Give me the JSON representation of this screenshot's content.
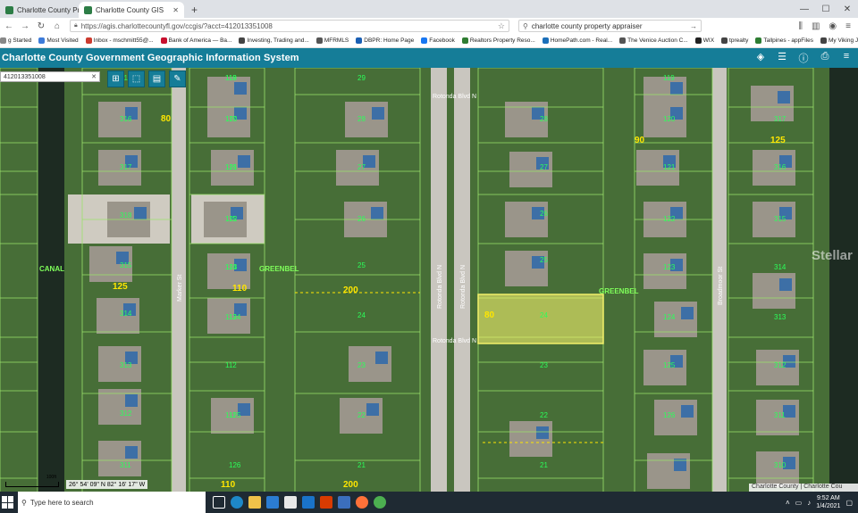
{
  "browser": {
    "tabs": [
      {
        "title": "Charlotte County Property App",
        "active": false,
        "color": "#2d7d46"
      },
      {
        "title": "Charlotte County GIS",
        "active": true,
        "color": "#2d7d46"
      }
    ],
    "new_tab": "+",
    "url": "https://agis.charlottecountyfl.gov/ccgis/?acct=412013351008",
    "search_value": "charlotte county property appraiser",
    "bookmarks": [
      "g Started",
      "Most Visited",
      "Inbox - mschmitt55@...",
      "Bank of America — Ba...",
      "Investing, Trading and...",
      "MFRMLS",
      "DBPR: Home Page",
      "Facebook",
      "Realtors Property Reso...",
      "HomePath.com - Real...",
      "The Venice Auction C...",
      "WIX",
      "tprealty",
      "Tallpines - appFiles",
      "My Viking Journey - Vi..."
    ]
  },
  "app": {
    "title": "Charlotte County Government Geographic Information System",
    "accent": "#157d98",
    "header_icons": [
      "layers-icon",
      "list-icon",
      "info-icon",
      "print-icon",
      "menu-icon"
    ]
  },
  "map": {
    "search_value": "412013351008",
    "clear_label": "✕",
    "tools": [
      "grid-icon",
      "select-icon",
      "notes-icon",
      "edit-icon"
    ],
    "highlight_color": "#f2f06a",
    "lot_line_color": "#9be36b",
    "lot_text_color": "#ffe600",
    "labels": {
      "canal": "CANAL",
      "greenbelt_left": "GREENBEL",
      "greenbelt_right": "GREENBEL",
      "rotonda_top": "Rotonda Blvd N",
      "rotonda_mid": "Rotonda Blvd N",
      "rotonda_v1": "Rotonda Blvd N",
      "rotonda_v2": "Rotonda Blvd N",
      "marker_st": "Marker St",
      "broadmoor_st": "Broadmoor St"
    },
    "lots": [
      "118",
      "117",
      "116",
      "115",
      "114",
      "113",
      "112",
      "111",
      "119",
      "120",
      "121",
      "122",
      "123",
      "124",
      "125",
      "126",
      "29",
      "28",
      "27",
      "26",
      "25",
      "24",
      "23",
      "22",
      "21",
      "21",
      "22",
      "23",
      "24",
      "25",
      "26",
      "27",
      "28",
      "119",
      "120",
      "121",
      "122",
      "123",
      "124",
      "125",
      "126",
      "316",
      "317",
      "318",
      "315",
      "314",
      "313",
      "312",
      "311",
      "310",
      "317",
      "316",
      "315",
      "314",
      "313",
      "312",
      "311",
      "310"
    ],
    "dims": [
      "80",
      "125",
      "200",
      "110",
      "200",
      "110",
      "125",
      "80",
      "90"
    ],
    "watermark": "Stellar",
    "coordinates": "26° 54' 09\" N 82° 16' 17\" W",
    "scale_label": "100ft",
    "attribution": "Charlotte County | Charlotte Cou"
  },
  "taskbar": {
    "search_placeholder": "Type here to search",
    "time": "9:52 AM",
    "date": "1/4/2021"
  }
}
